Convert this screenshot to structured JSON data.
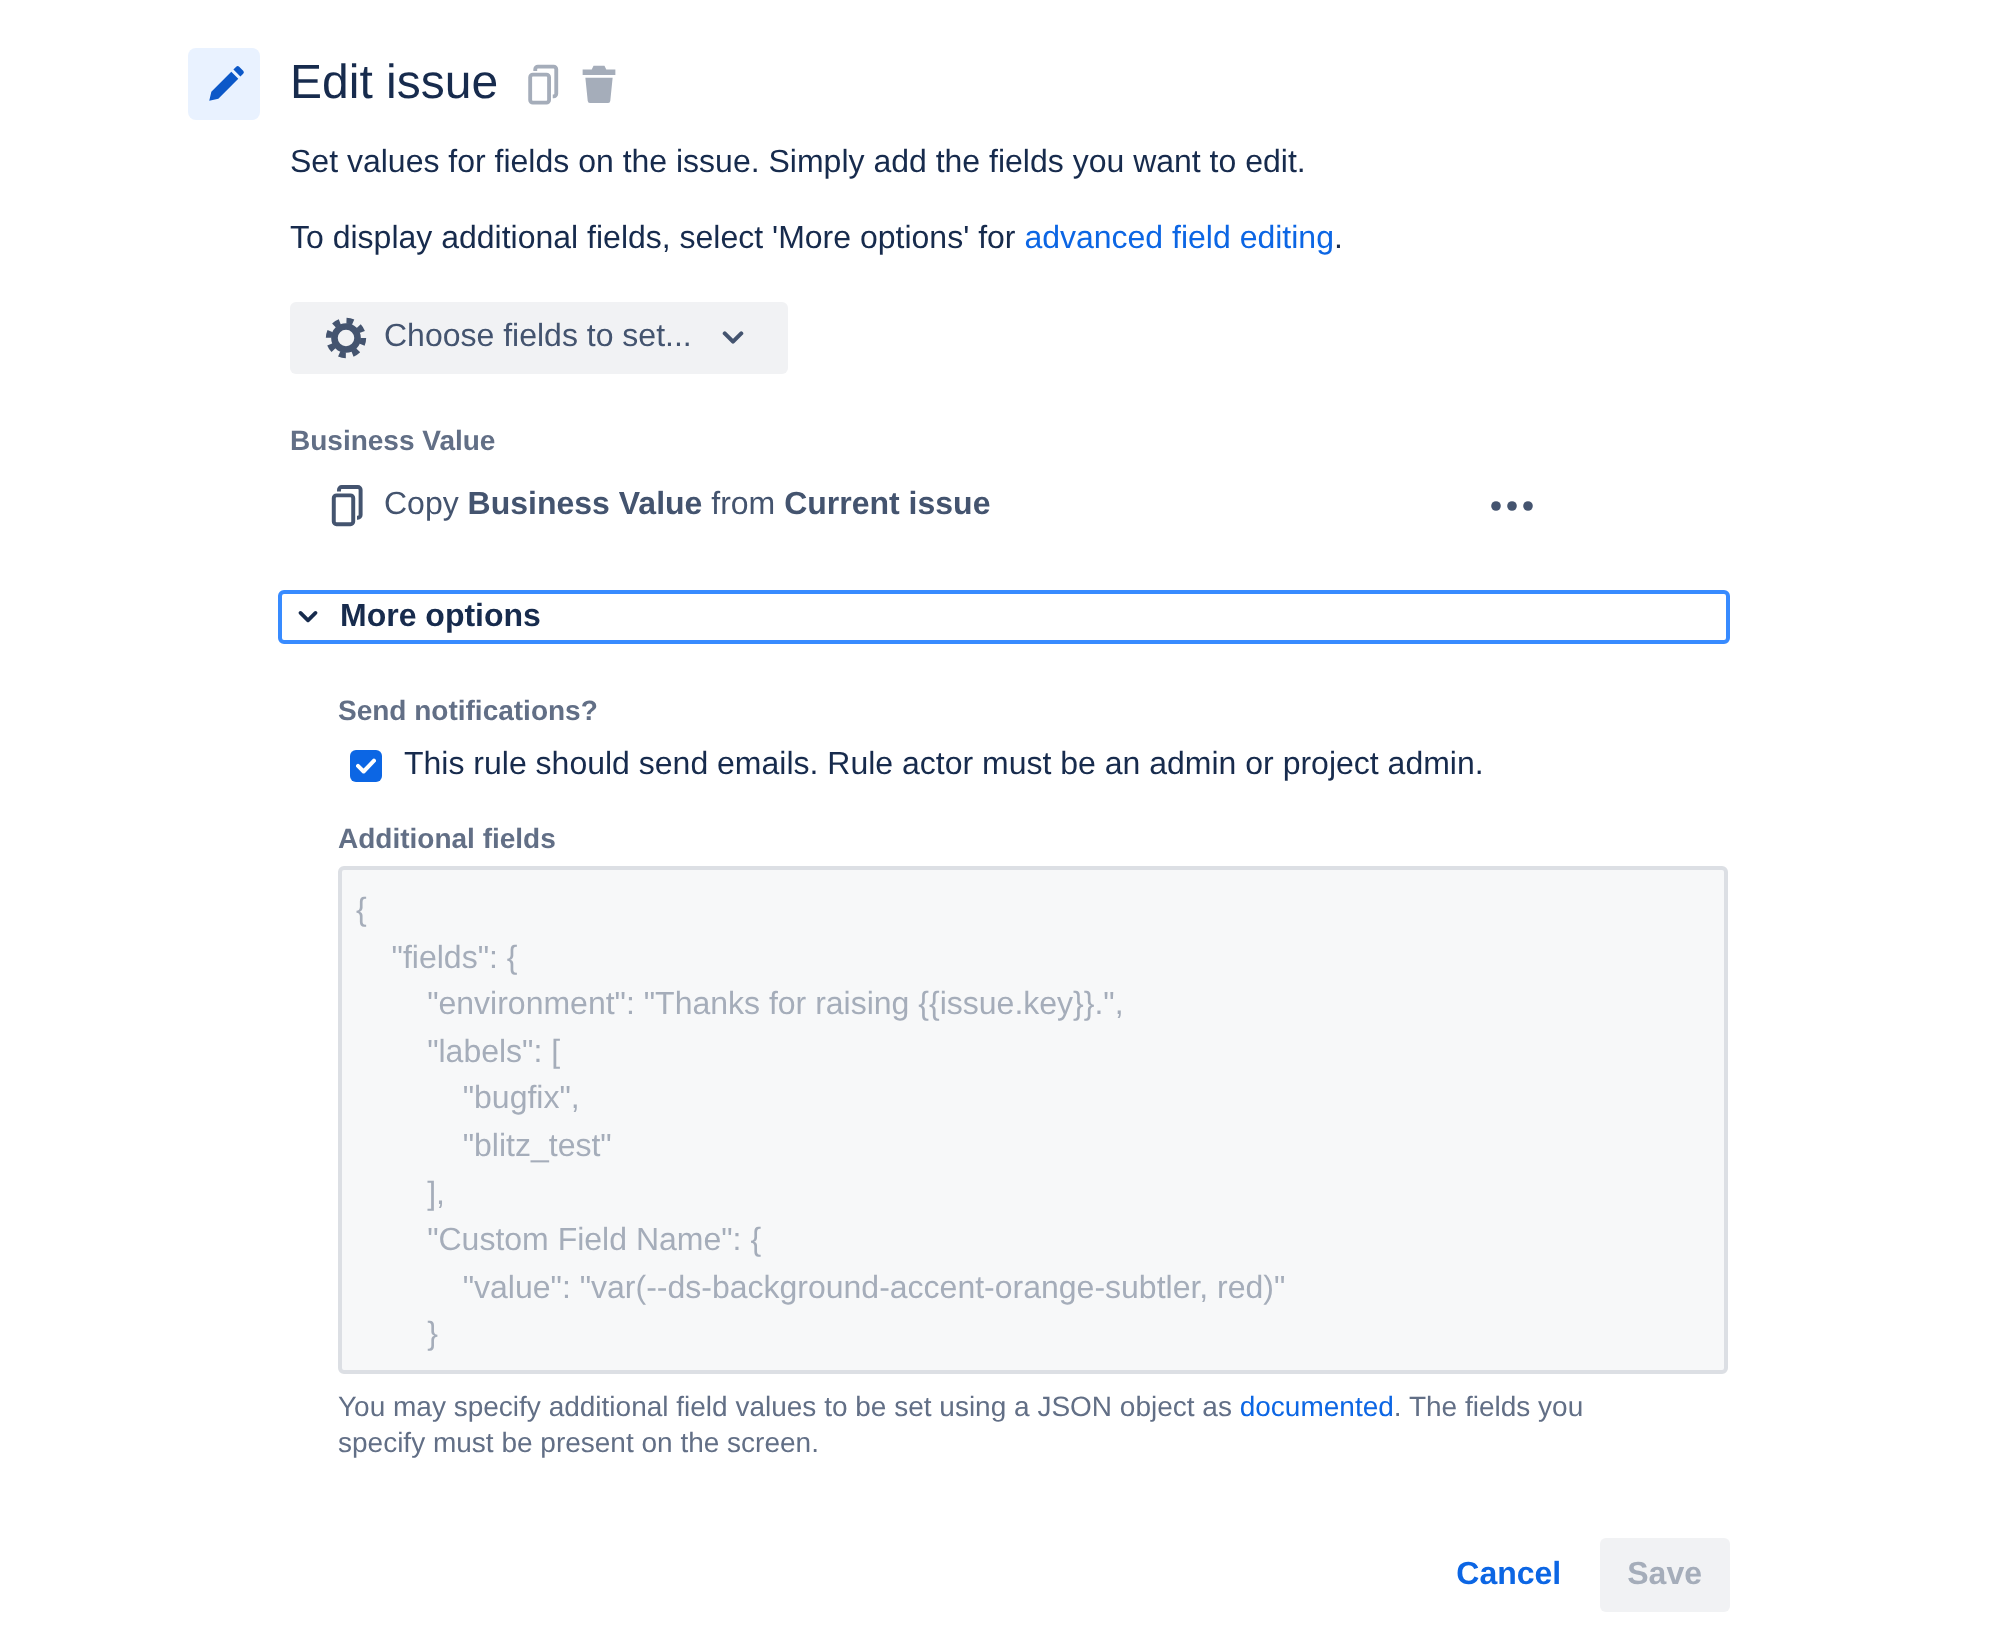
{
  "header": {
    "title": "Edit issue"
  },
  "description": [
    {
      "text": "Set values for fields on the issue. Simply add the fields you want to edit."
    },
    {
      "text": "To display additional fields, select 'More options' for ",
      "link": "advanced field editing",
      "after": "."
    }
  ],
  "choose_fields": {
    "label": "Choose fields to set..."
  },
  "fields": [
    {
      "label": "Business Value",
      "value": "Copy **Business Value** from **Current issue**"
    }
  ],
  "more_options": {
    "label": "More options",
    "expanded": true,
    "notifications": {
      "label": "Send notifications?",
      "option": {
        "label": "This rule should send emails. Rule actor must be an admin or project admin.",
        "checked": true
      }
    },
    "additional_fields": {
      "label": "Additional fields",
      "placeholder": "{\n    \"fields\": {\n        \"environment\": \"Thanks for raising {{issue.key}}.\",\n        \"labels\": [\n            \"bugfix\",\n            \"blitz_test\"\n        ],\n        \"Custom Field Name\": {\n            \"value\": \"var(--ds-background-accent-orange-subtler, red)\"\n        }",
      "help": {
        "text": "You may specify additional field values to be set using a JSON object as ",
        "link": "documented",
        "after": ". The fields you specify must be present on the screen."
      }
    }
  },
  "buttons": [
    {
      "label": "Cancel",
      "kind": "subtle",
      "disabled": false
    },
    {
      "label": "Save",
      "kind": "primary",
      "disabled": true
    }
  ]
}
